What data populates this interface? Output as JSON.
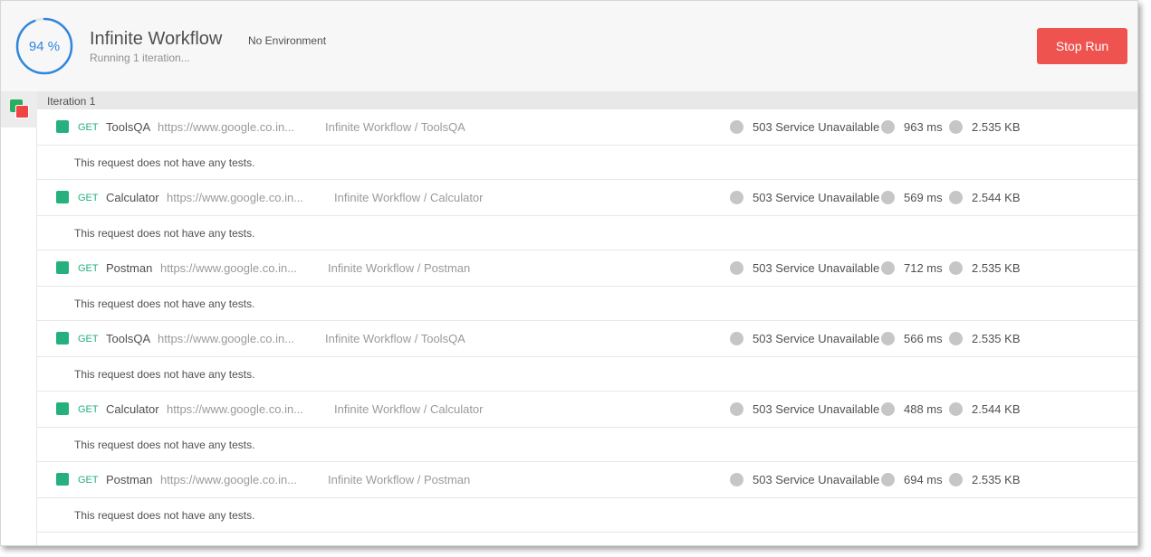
{
  "header": {
    "progress_text": "94 %",
    "progress_value": 94,
    "title": "Infinite Workflow",
    "environment": "No Environment",
    "status": "Running 1 iteration...",
    "stop_label": "Stop Run"
  },
  "iteration": {
    "label": "Iteration 1"
  },
  "colors": {
    "accent": "#2f86e0",
    "success": "#26b07e",
    "danger": "#ef5350"
  },
  "requests": [
    {
      "method": "GET",
      "name": "ToolsQA",
      "url": "https://www.google.co.in...",
      "path": "Infinite Workflow / ToolsQA",
      "status": "503 Service Unavailable",
      "time": "963 ms",
      "size": "2.535 KB",
      "tests": "This request does not have any tests."
    },
    {
      "method": "GET",
      "name": "Calculator",
      "url": "https://www.google.co.in...",
      "path": "Infinite Workflow / Calculator",
      "status": "503 Service Unavailable",
      "time": "569 ms",
      "size": "2.544 KB",
      "tests": "This request does not have any tests."
    },
    {
      "method": "GET",
      "name": "Postman",
      "url": "https://www.google.co.in...",
      "path": "Infinite Workflow / Postman",
      "status": "503 Service Unavailable",
      "time": "712 ms",
      "size": "2.535 KB",
      "tests": "This request does not have any tests."
    },
    {
      "method": "GET",
      "name": "ToolsQA",
      "url": "https://www.google.co.in...",
      "path": "Infinite Workflow / ToolsQA",
      "status": "503 Service Unavailable",
      "time": "566 ms",
      "size": "2.535 KB",
      "tests": "This request does not have any tests."
    },
    {
      "method": "GET",
      "name": "Calculator",
      "url": "https://www.google.co.in...",
      "path": "Infinite Workflow / Calculator",
      "status": "503 Service Unavailable",
      "time": "488 ms",
      "size": "2.544 KB",
      "tests": "This request does not have any tests."
    },
    {
      "method": "GET",
      "name": "Postman",
      "url": "https://www.google.co.in...",
      "path": "Infinite Workflow / Postman",
      "status": "503 Service Unavailable",
      "time": "694 ms",
      "size": "2.535 KB",
      "tests": "This request does not have any tests."
    }
  ]
}
